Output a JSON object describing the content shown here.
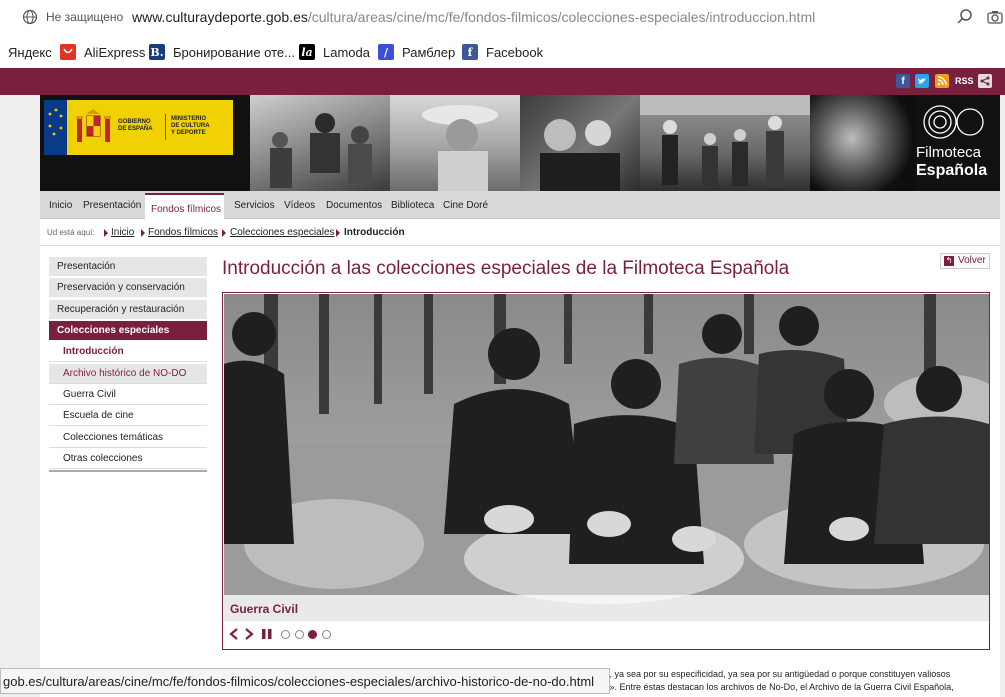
{
  "browser": {
    "security_label": "Не защищено",
    "url_host": "www.culturaydeporte.gob.es",
    "url_path": "/cultura/areas/cine/mc/fe/fondos-filmicos/colecciones-especiales/introduccion.html",
    "bookmarks": [
      {
        "label": "Яндекс",
        "icon": "none"
      },
      {
        "label": "AliExpress",
        "icon": "aliexpress-icon",
        "color": "#e43225"
      },
      {
        "label": "Бронирование оте...",
        "icon": "booking-icon",
        "color": "#1b3b7a",
        "glyph": "B."
      },
      {
        "label": "Lamoda",
        "icon": "lamoda-icon",
        "color": "#000000",
        "glyph": "la"
      },
      {
        "label": "Рамблер",
        "icon": "rambler-icon",
        "color": "#3d4fd8",
        "glyph": "/"
      },
      {
        "label": "Facebook",
        "icon": "facebook-icon",
        "color": "#3b5998",
        "glyph": "f"
      }
    ],
    "status_url": "gob.es/cultura/areas/cine/mc/fe/fondos-filmicos/colecciones-especiales/archivo-historico-de-no-do.html"
  },
  "site": {
    "accent": "#7b1f3f",
    "social": {
      "rss_label": "RSS"
    },
    "logo": {
      "gov_line1": "GOBIERNO",
      "gov_line2": "DE ESPAÑA",
      "min_line1": "MINISTERIO",
      "min_line2": "DE CULTURA",
      "min_line3": "Y DEPORTE"
    },
    "brand_line1": "Filmoteca",
    "brand_line2": "Española",
    "nav": [
      "Inicio",
      "Presentación",
      "Fondos fílmicos",
      "Servicios",
      "Vídeos",
      "Documentos",
      "Biblioteca",
      "Cine Doré"
    ],
    "breadcrumb": {
      "label": "Ud está aquí:",
      "items": [
        "Inicio",
        "Fondos fílmicos",
        "Colecciones especiales"
      ],
      "current": "Introducción"
    },
    "sidebar": {
      "items": [
        "Presentación",
        "Preservación y conservación",
        "Recuperación y restauración",
        "Colecciones especiales"
      ],
      "sub": [
        "Introducción",
        "Archivo histórico de NO-DO",
        "Guerra Civil",
        "Escuela de cine",
        "Colecciones temáticas",
        "Otras colecciones"
      ]
    },
    "title": "Introducción a las colecciones especiales de la Filmoteca Española",
    "volver": "Volver",
    "slider": {
      "caption": "Guerra Civil",
      "slides": 4,
      "active_slide": 3
    },
    "body_line1": "és, ya sea por su especificidad, ya sea por su antigüedad o porque constituyen valiosos",
    "body_line2": "es». Entre éstas destacan los archivos de No-Do, el Archivo de la Guerra Civil Española,"
  }
}
